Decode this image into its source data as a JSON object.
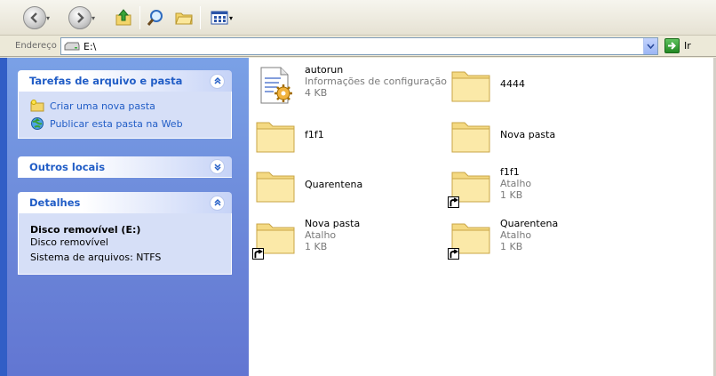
{
  "toolbar": {
    "back_icon": "back-arrow-icon",
    "forward_icon": "forward-arrow-icon",
    "up_icon": "up-folder-icon",
    "search_icon": "search-icon",
    "folders_icon": "folders-icon",
    "views_icon": "views-icon"
  },
  "address": {
    "label": "Endereço",
    "value": "E:\\",
    "go_label": "Ir"
  },
  "tasks_panel": {
    "title": "Tarefas de arquivo e pasta",
    "items": [
      {
        "label": "Criar uma nova pasta",
        "icon": "new-folder-icon"
      },
      {
        "label": "Publicar esta pasta na Web",
        "icon": "publish-web-icon"
      }
    ]
  },
  "other_places": {
    "title": "Outros locais"
  },
  "details": {
    "title": "Detalhes",
    "name": "Disco removível (E:)",
    "type": "Disco removível",
    "filesystem": "Sistema de arquivos: NTFS"
  },
  "files": [
    {
      "name": "autorun",
      "line2": "Informações de configuração",
      "line3": "4 KB",
      "icon": "config-file-icon",
      "shortcut": false
    },
    {
      "name": "4444",
      "line2": "",
      "line3": "",
      "icon": "folder-icon",
      "shortcut": false
    },
    {
      "name": "f1f1",
      "line2": "",
      "line3": "",
      "icon": "folder-icon",
      "shortcut": false
    },
    {
      "name": "Nova pasta",
      "line2": "",
      "line3": "",
      "icon": "folder-icon",
      "shortcut": false
    },
    {
      "name": "Quarentena",
      "line2": "",
      "line3": "",
      "icon": "folder-icon",
      "shortcut": false
    },
    {
      "name": "f1f1",
      "line2": "Atalho",
      "line3": "1 KB",
      "icon": "folder-shortcut-icon",
      "shortcut": true
    },
    {
      "name": "Nova pasta",
      "line2": "Atalho",
      "line3": "1 KB",
      "icon": "folder-shortcut-icon",
      "shortcut": true
    },
    {
      "name": "Quarentena",
      "line2": "Atalho",
      "line3": "1 KB",
      "icon": "folder-shortcut-icon",
      "shortcut": true
    }
  ]
}
